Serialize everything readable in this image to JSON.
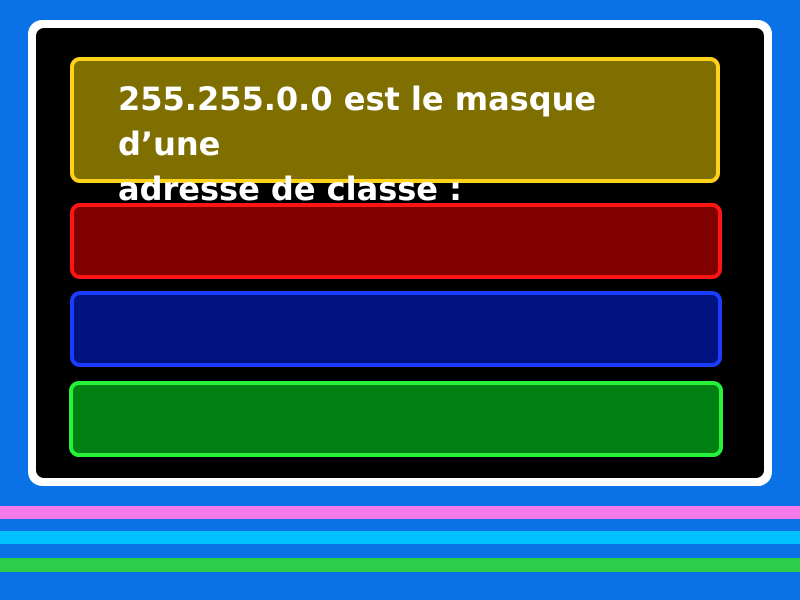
{
  "colors": {
    "background": "#0a72e6",
    "board_frame": "#ffffff",
    "board_fill": "#000000",
    "question_fill": "#7f6e00",
    "question_border": "#ffd21a",
    "answer_red_fill": "#800000",
    "answer_red_border": "#ff1414",
    "answer_blue_fill": "#001280",
    "answer_blue_border": "#1a3cff",
    "answer_green_fill": "#008012",
    "answer_green_border": "#27f23a",
    "stripe_pink": "#f57aea",
    "stripe_cyan": "#00c0ff",
    "stripe_green": "#2ccd49"
  },
  "question": {
    "text": "255.255.0.0 est le masque d’une\nadresse de classe :"
  },
  "answers": [
    {
      "label": ""
    },
    {
      "label": ""
    },
    {
      "label": ""
    }
  ]
}
